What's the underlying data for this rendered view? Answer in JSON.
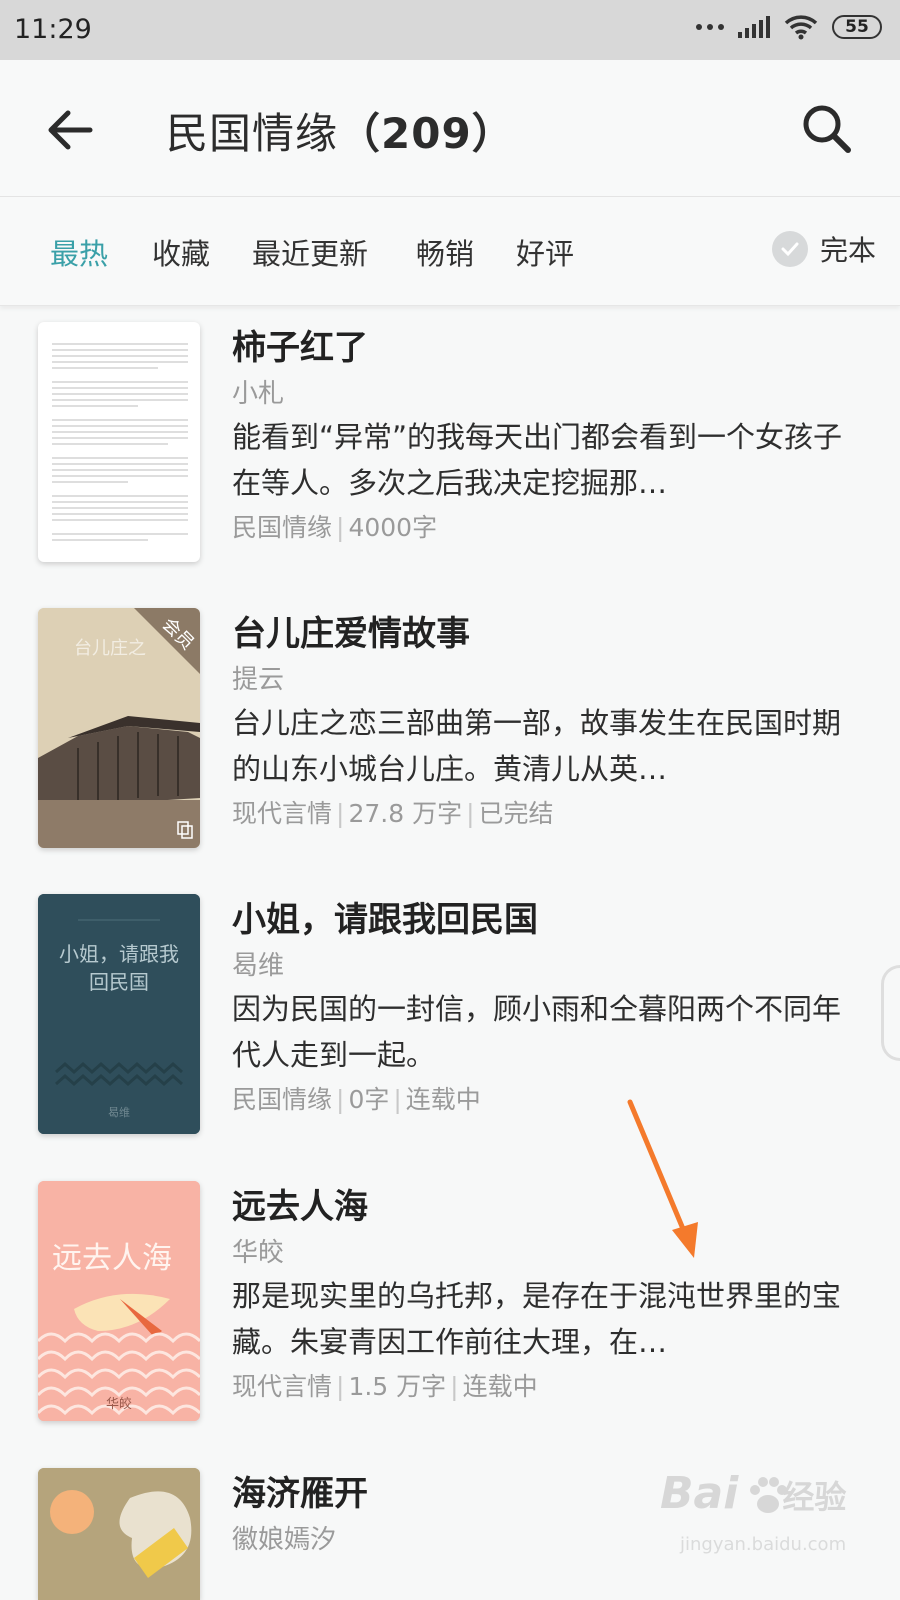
{
  "status_bar": {
    "time": "11:29",
    "battery": "55"
  },
  "header": {
    "title": "民国情缘",
    "count": "（209）"
  },
  "filters": {
    "tabs": [
      {
        "label": "最热",
        "active": true
      },
      {
        "label": "收藏",
        "active": false
      },
      {
        "label": "最近更新",
        "active": false
      },
      {
        "label": "畅销",
        "active": false
      },
      {
        "label": "好评",
        "active": false
      }
    ],
    "finished_label": "完本"
  },
  "books": [
    {
      "title": "柿子红了",
      "author": "小札",
      "description": "能看到“异常”的我每天出门都会看到一个女孩子在等人。多次之后我决定挖掘那…",
      "category": "民国情缘",
      "words": "4000字",
      "status": ""
    },
    {
      "title": "台儿庄爱情故事",
      "author": "提云",
      "description": "台儿庄之恋三部曲第一部，故事发生在民国时期的山东小城台儿庄。黄清儿从英…",
      "category": "现代言情",
      "words": "27.8 万字",
      "status": "已完结",
      "cover_text": "台儿庄之",
      "badge": "会员"
    },
    {
      "title": "小姐，请跟我回民国",
      "author": "曷维",
      "description": "因为民国的一封信，顾小雨和仝暮阳两个不同年代人走到一起。",
      "category": "民国情缘",
      "words": "0字",
      "status": "连载中",
      "cover_text": "小姐，请跟我回民国",
      "cover_author": "曷维"
    },
    {
      "title": "远去人海",
      "author": "华皎",
      "description": "那是现实里的乌托邦，是存在于混沌世界里的宝藏。朱宴青因工作前往大理，在…",
      "category": "现代言情",
      "words": "1.5 万字",
      "status": "连载中",
      "cover_text": "远去人海",
      "cover_author": "华皎"
    },
    {
      "title": "海济雁开",
      "author": "徽娘嫣汐"
    }
  ],
  "watermark": {
    "brand": "Bai",
    "brand2": "经验",
    "url": "jingyan.baidu.com"
  },
  "colors": {
    "accent": "#3aa0a8",
    "arrow": "#f47a2c"
  }
}
